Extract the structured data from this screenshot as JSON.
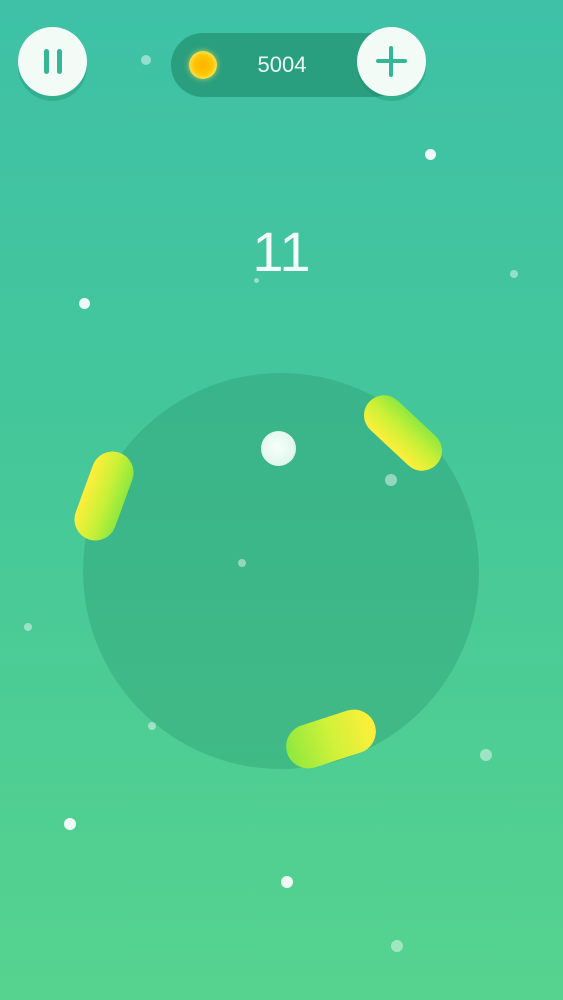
{
  "hud": {
    "pause_icon": "pause-icon",
    "coin_icon": "coin-icon",
    "coins": "5004",
    "add_icon": "plus-icon"
  },
  "game": {
    "score": "11",
    "colors": {
      "background_top": "#3ec1a6",
      "background_bottom": "#56d38e",
      "paddle_start": "#ffef3a",
      "paddle_end": "#8ee83e",
      "coin": "#ffc400"
    }
  }
}
